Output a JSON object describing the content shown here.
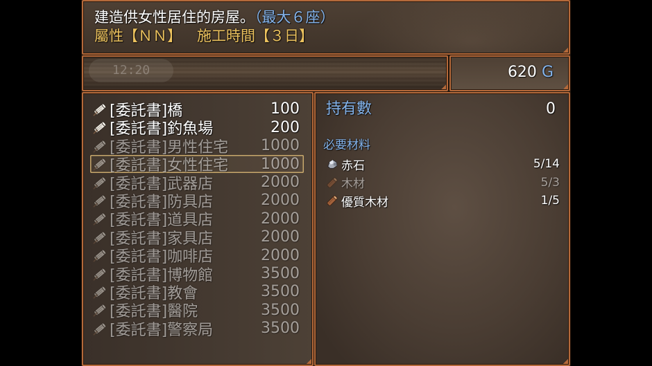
{
  "help": {
    "description": "建造供女性居住的房屋。",
    "max_note": "（最大６座）",
    "attribute": "屬性【ＮＮ】",
    "build_time": "施工時間【３日】"
  },
  "background": {
    "clock_time": "12:20"
  },
  "gold": {
    "amount": "620",
    "currency": "G"
  },
  "shop_list": {
    "selected_index": 3,
    "item_icon": "scroll-icon",
    "items": [
      {
        "name": "[委託書]橋",
        "price": "100",
        "enabled": true
      },
      {
        "name": "[委託書]釣魚場",
        "price": "200",
        "enabled": true
      },
      {
        "name": "[委託書]男性住宅",
        "price": "1000",
        "enabled": false
      },
      {
        "name": "[委託書]女性住宅",
        "price": "1000",
        "enabled": false
      },
      {
        "name": "[委託書]武器店",
        "price": "2000",
        "enabled": false
      },
      {
        "name": "[委託書]防具店",
        "price": "2000",
        "enabled": false
      },
      {
        "name": "[委託書]道具店",
        "price": "2000",
        "enabled": false
      },
      {
        "name": "[委託書]家具店",
        "price": "2000",
        "enabled": false
      },
      {
        "name": "[委託書]咖啡店",
        "price": "2000",
        "enabled": false
      },
      {
        "name": "[委託書]博物館",
        "price": "3500",
        "enabled": false
      },
      {
        "name": "[委託書]教會",
        "price": "3500",
        "enabled": false
      },
      {
        "name": "[委託書]醫院",
        "price": "3500",
        "enabled": false
      },
      {
        "name": "[委託書]警察局",
        "price": "3500",
        "enabled": false
      }
    ]
  },
  "status": {
    "possession_label": "持有數",
    "possession_value": "0",
    "materials_label": "必要材料",
    "materials": [
      {
        "name": "赤石",
        "count": "5/14",
        "icon": "ore-icon",
        "enabled": true
      },
      {
        "name": "木材",
        "count": "5/3",
        "icon": "wood-log-icon",
        "enabled": false
      },
      {
        "name": "優質木材",
        "count": "1/5",
        "icon": "wood-log-icon",
        "enabled": true
      }
    ]
  },
  "colors": {
    "window_frame": "#b4693a",
    "system_text": "#84b4ec",
    "highlight_text": "#ecc25e",
    "selection_frame": "#c8a86c",
    "normal_text": "#ffffff"
  }
}
